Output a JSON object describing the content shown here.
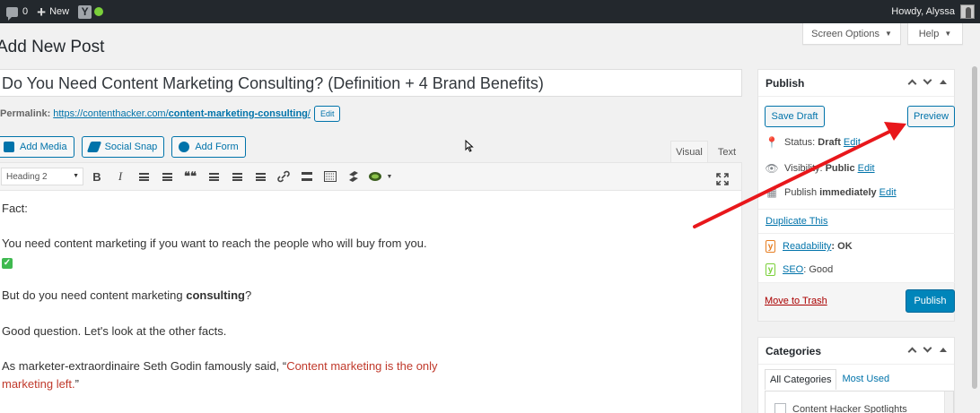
{
  "admin_bar": {
    "comment_count": "0",
    "new_label": "New",
    "yoast_label": "Y",
    "howdy": "Howdy, Alyssa"
  },
  "screen_options": {
    "screen_options_label": "Screen Options",
    "help_label": "Help"
  },
  "page": {
    "title": "Add New Post"
  },
  "post": {
    "title": "Do You Need Content Marketing Consulting? (Definition + 4 Brand Benefits)",
    "permalink_label": "Permalink:",
    "permalink_base": "https://contenthacker.com/",
    "permalink_slug": "content-marketing-consulting",
    "permalink_tail": "/",
    "edit_label": "Edit"
  },
  "media_buttons": {
    "add_media": "Add Media",
    "social_snap": "Social Snap",
    "add_form": "Add Form"
  },
  "editor_tabs": {
    "visual": "Visual",
    "text": "Text"
  },
  "toolbar": {
    "format_value": "Heading 2",
    "bold": "B",
    "italic": "I",
    "quote": "❝❝"
  },
  "content": {
    "p1": "Fact:",
    "p2": "You need content marketing if you want to reach the people who will buy from you.",
    "p2_check": "✓",
    "p3_pre": "But do you need content marketing ",
    "p3_bold": "consulting",
    "p3_post": "?",
    "p4": "Good question. Let's look at the other facts.",
    "p5_pre": "As marketer-extraordinaire Seth Godin famously said, “",
    "p5_quote_1": "Content marketing is the only",
    "p5_quote_2": "marketing left.",
    "p5_post": "”"
  },
  "publish_box": {
    "title": "Publish",
    "save_draft": "Save Draft",
    "preview": "Preview",
    "status_label": "Status:",
    "status_value": "Draft",
    "status_edit": "Edit",
    "visibility_label": "Visibility:",
    "visibility_value": "Public",
    "visibility_edit": "Edit",
    "publish_label": "Publish",
    "publish_value": "immediately",
    "publish_edit": "Edit",
    "duplicate": "Duplicate This",
    "readability_label": "Readability",
    "readability_value": ": OK",
    "seo_label": "SEO",
    "seo_value": ": Good",
    "trash": "Move to Trash",
    "publish_button": "Publish"
  },
  "categories_box": {
    "title": "Categories",
    "tab_all": "All Categories",
    "tab_used": "Most Used",
    "first_item": "Content Hacker Spotlights"
  },
  "colors": {
    "admin_bar": "#23282d",
    "link": "#0073aa",
    "primary_button": "#0085ba",
    "annotation_arrow": "#e8171b",
    "quote_text": "#c0392b"
  }
}
